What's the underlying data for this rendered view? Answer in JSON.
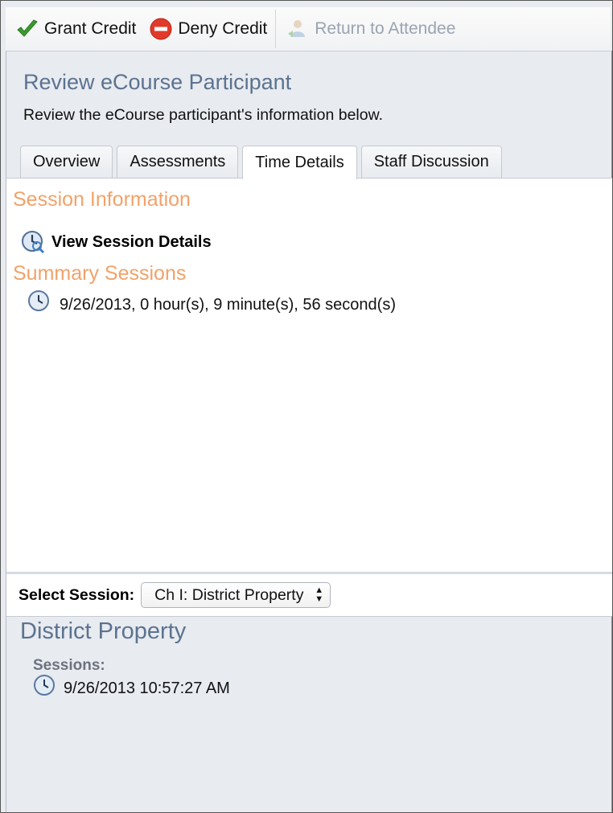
{
  "toolbar": {
    "grant_label": "Grant Credit",
    "deny_label": "Deny Credit",
    "return_label": "Return to Attendee"
  },
  "header": {
    "title": "Review eCourse Participant",
    "subtitle": "Review the eCourse participant's information below."
  },
  "tabs": [
    {
      "label": "Overview",
      "active": false
    },
    {
      "label": "Assessments",
      "active": false
    },
    {
      "label": "Time Details",
      "active": true
    },
    {
      "label": "Staff Discussion",
      "active": false
    }
  ],
  "session_info": {
    "title": "Session Information",
    "view_details_label": "View Session Details"
  },
  "summary": {
    "title": "Summary Sessions",
    "rows": [
      "9/26/2013, 0 hour(s), 9 minute(s), 56 second(s)"
    ]
  },
  "select_session": {
    "label": "Select Session:",
    "value": "Ch I: District Property"
  },
  "detail": {
    "title": "District Property",
    "sessions_label": "Sessions:",
    "sessions": [
      "9/26/2013 10:57:27 AM"
    ]
  },
  "colors": {
    "section_title": "#f2a26a",
    "heading_blue": "#5b7391",
    "background": "#e8ebef"
  }
}
